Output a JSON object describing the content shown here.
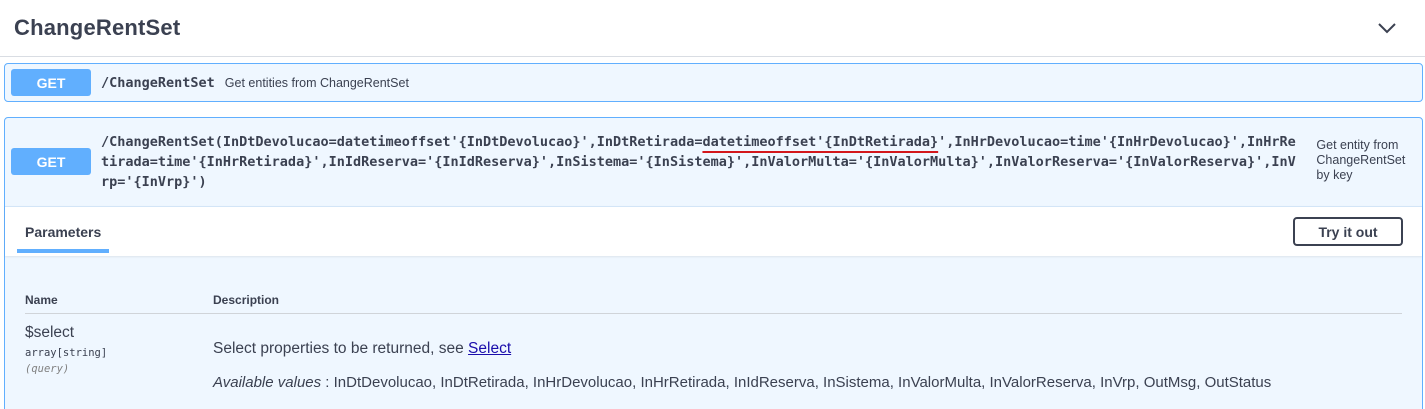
{
  "section": {
    "title": "ChangeRentSet"
  },
  "operations": [
    {
      "method": "GET",
      "path": "/ChangeRentSet",
      "summary": "Get entities from ChangeRentSet"
    },
    {
      "method": "GET",
      "path_before": "/ChangeRentSet(InDtDevolucao=datetimeoffset'{InDtDevolucao}',InDtRetirada=",
      "path_highlight": "datetimeoffset'{InDtRetirada}",
      "path_after": "',InHrDevolucao=time'{InHrDevolucao}',InHrRetirada=time'{InHrRetirada}',InIdReserva='{InIdReserva}',InSistema='{InSistema}',InValorMulta='{InValorMulta}',InValorReserva='{InValorReserva}',InVrp='{InVrp}')",
      "summary": "Get entity from ChangeRentSet by key"
    }
  ],
  "tabs": {
    "parameters": "Parameters"
  },
  "try_it_out": "Try it out",
  "table": {
    "col_name": "Name",
    "col_description": "Description"
  },
  "param": {
    "name": "$select",
    "type": "array[string]",
    "in": "(query)",
    "description": "Select properties to be returned, see ",
    "link": "Select",
    "available_label": "Available values",
    "available_values": " : InDtDevolucao, InDtRetirada, InHrDevolucao, InHrRetirada, InIdReserva, InSistema, InValorMulta, InValorReserva, InVrp, OutMsg, OutStatus"
  },
  "colors": {
    "get": "#61affe",
    "underline": "#d3171b",
    "text": "#3b4151"
  }
}
